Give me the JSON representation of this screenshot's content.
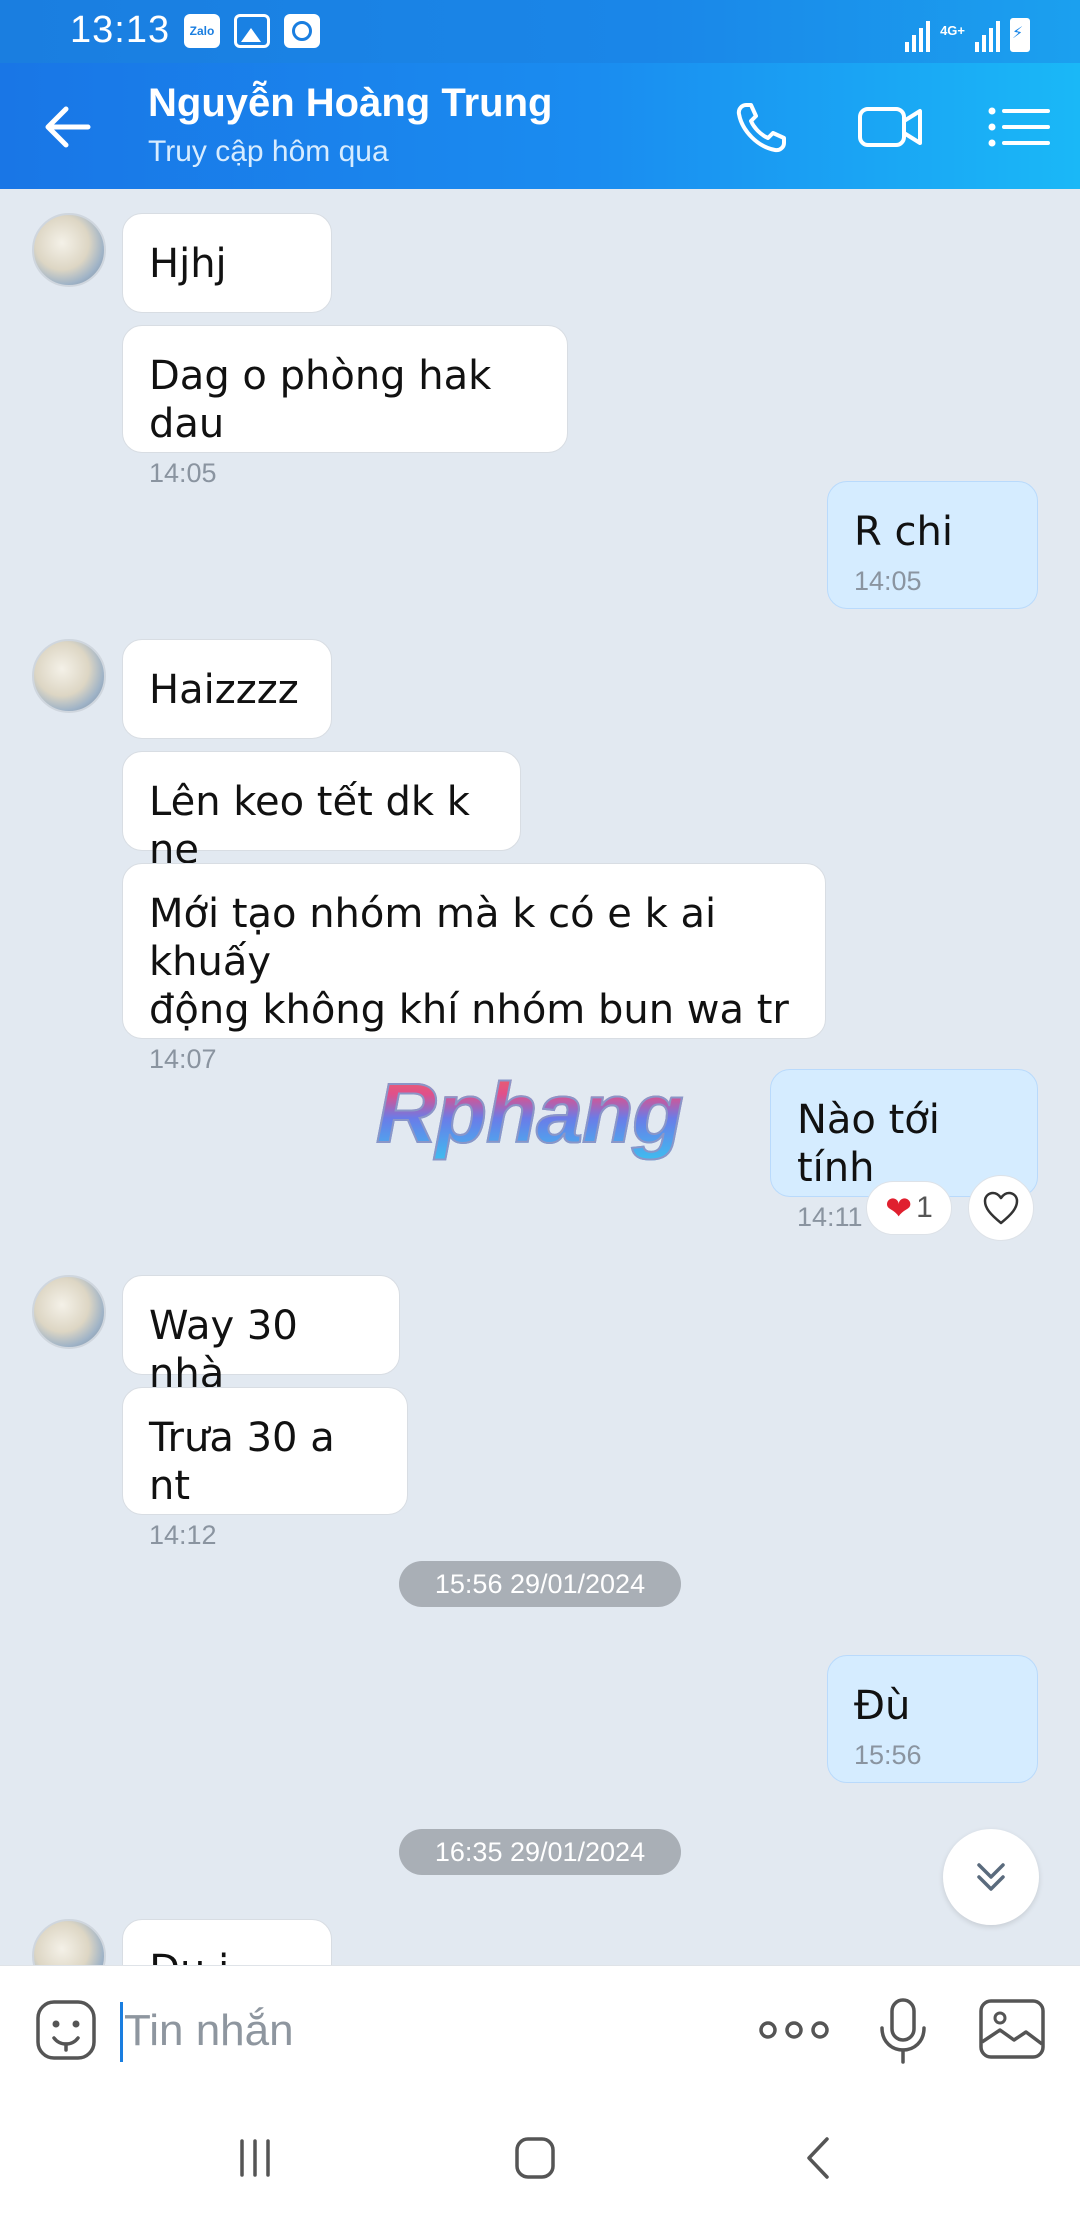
{
  "status_bar": {
    "time": "13:13",
    "zalo_label": "Zalo",
    "network": "4G+"
  },
  "header": {
    "contact_name": "Nguyễn Hoàng Trung",
    "status": "Truy cập hôm qua"
  },
  "messages": [
    {
      "text": "Hjhj",
      "time": ""
    },
    {
      "text": "Dag o phòng hak dau",
      "time": "14:05"
    },
    {
      "text": "R chi",
      "time": "14:05"
    },
    {
      "text": "Haizzzz",
      "time": ""
    },
    {
      "text": "Lên keo tết dk k ne",
      "time": ""
    },
    {
      "text": "Mới tạo nhóm mà k có e k ai khuấy\nđộng không khí nhóm bun wa tr",
      "time": "14:07"
    },
    {
      "text": "Nào tới tính",
      "time": "14:11"
    },
    {
      "text": "Way 30 nhà",
      "time": ""
    },
    {
      "text": "Trưa 30 a nt",
      "time": "14:12"
    },
    {
      "text": "Đù",
      "time": "15:56"
    },
    {
      "text": "Đu i",
      "time": ""
    }
  ],
  "date_separators": [
    "15:56 29/01/2024",
    "16:35 29/01/2024"
  ],
  "reaction": {
    "emoji": "❤",
    "count": "1"
  },
  "watermark": "Rphang",
  "composer": {
    "placeholder": "Tin nhắn"
  },
  "colors": {
    "header_start": "#1976e6",
    "header_end": "#1ab8f7",
    "my_bubble": "#d5ecff",
    "chat_bg": "#e2e9f1"
  }
}
